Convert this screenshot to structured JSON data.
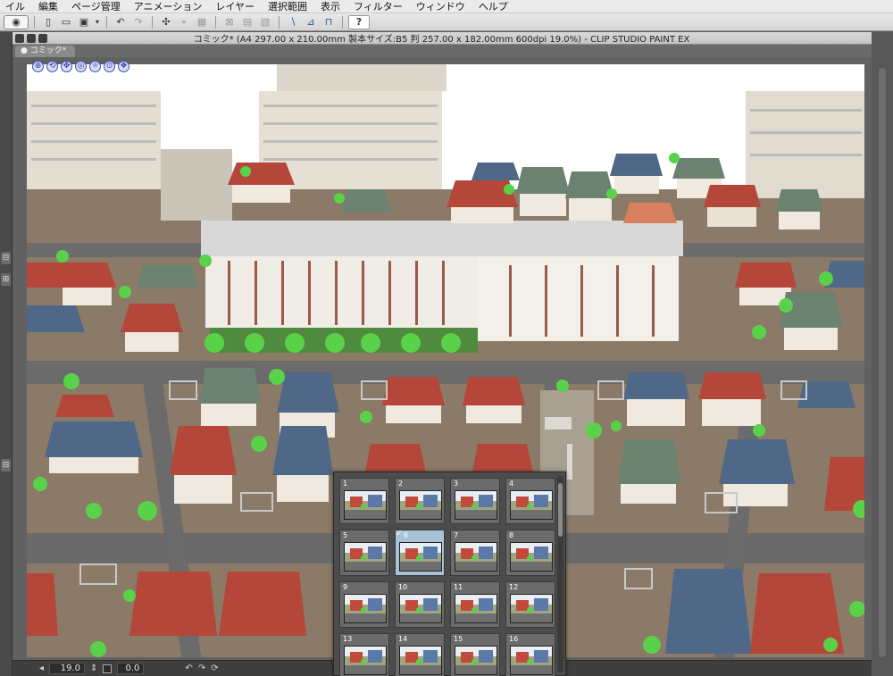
{
  "menu": {
    "items": [
      "イル",
      "編集",
      "ページ管理",
      "アニメーション",
      "レイヤー",
      "選択範囲",
      "表示",
      "フィルター",
      "ウィンドウ",
      "ヘルプ"
    ]
  },
  "toolbar": {
    "icons": [
      "app-logo-icon",
      "new-file-icon",
      "open-file-icon",
      "save-icon",
      "save-dropdown-icon",
      "undo-icon",
      "redo-icon",
      "transform-icon",
      "fit-icon",
      "scale-icon",
      "clear-icon",
      "fill-icon",
      "ruler-snap-icon",
      "special-ruler-icon",
      "grid-snap-icon",
      "help-icon"
    ],
    "help_label": "?"
  },
  "window": {
    "title": "コミック* (A4 297.00 x 210.00mm 製本サイズ:B5 判 257.00 x 182.00mm 600dpi 19.0%) - CLIP STUDIO PAINT EX",
    "tab_label": "● コミック*"
  },
  "status": {
    "zoom": "19.0",
    "angle": "0.0"
  },
  "thumbnails": {
    "selected_index": 5,
    "check_mark": "✓",
    "pages": [
      "1",
      "2",
      "3",
      "4",
      "5",
      "6",
      "7",
      "8",
      "9",
      "10",
      "11",
      "12",
      "13",
      "14",
      "15",
      "16"
    ]
  },
  "colors": {
    "roof_red": "#b5473a",
    "roof_blue": "#4f6888",
    "roof_green": "#6c8270",
    "tree_green": "#59d24a",
    "road": "#6c6c6c",
    "ground": "#8a7865",
    "selection": "#a9c2d8"
  }
}
